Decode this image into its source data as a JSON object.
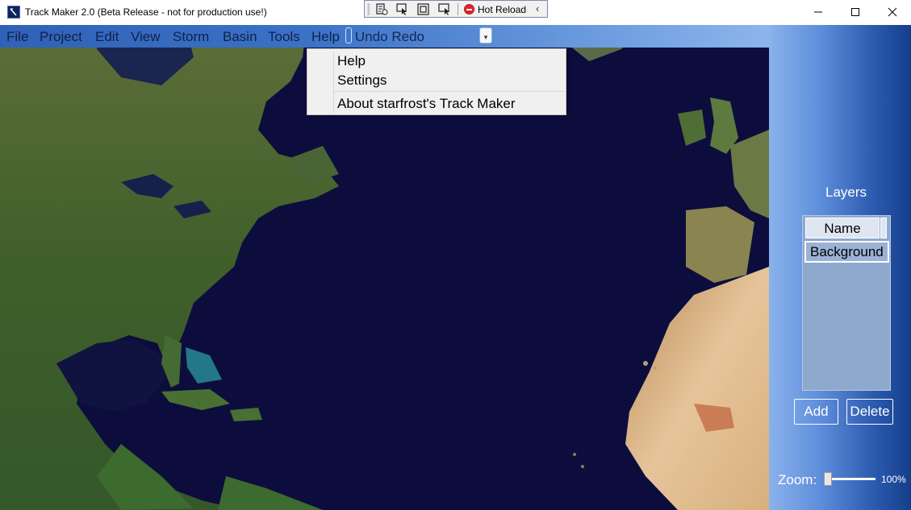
{
  "window": {
    "title": "Track Maker 2.0 (Beta Release - not for production use!)"
  },
  "debug_toolbar": {
    "hot_reload_label": "Hot Reload"
  },
  "menubar": {
    "items": [
      "File",
      "Project",
      "Edit",
      "View",
      "Storm",
      "Basin",
      "Tools",
      "Help"
    ],
    "undo_redo_label": "Undo Redo"
  },
  "help_menu": {
    "items": [
      "Help",
      "Settings",
      "About starfrost's Track Maker"
    ]
  },
  "layers_panel": {
    "title": "Layers",
    "column_header": "Name",
    "rows": [
      "Background"
    ],
    "add_label": "Add",
    "delete_label": "Delete"
  },
  "zoom": {
    "label": "Zoom:",
    "value_text": "100%",
    "level": 0.0
  },
  "colors": {
    "ocean": "#0d0d3d",
    "panel_dark": "#153e8a",
    "panel_light": "#8ab2ec",
    "menubar": "#3b72c6"
  }
}
